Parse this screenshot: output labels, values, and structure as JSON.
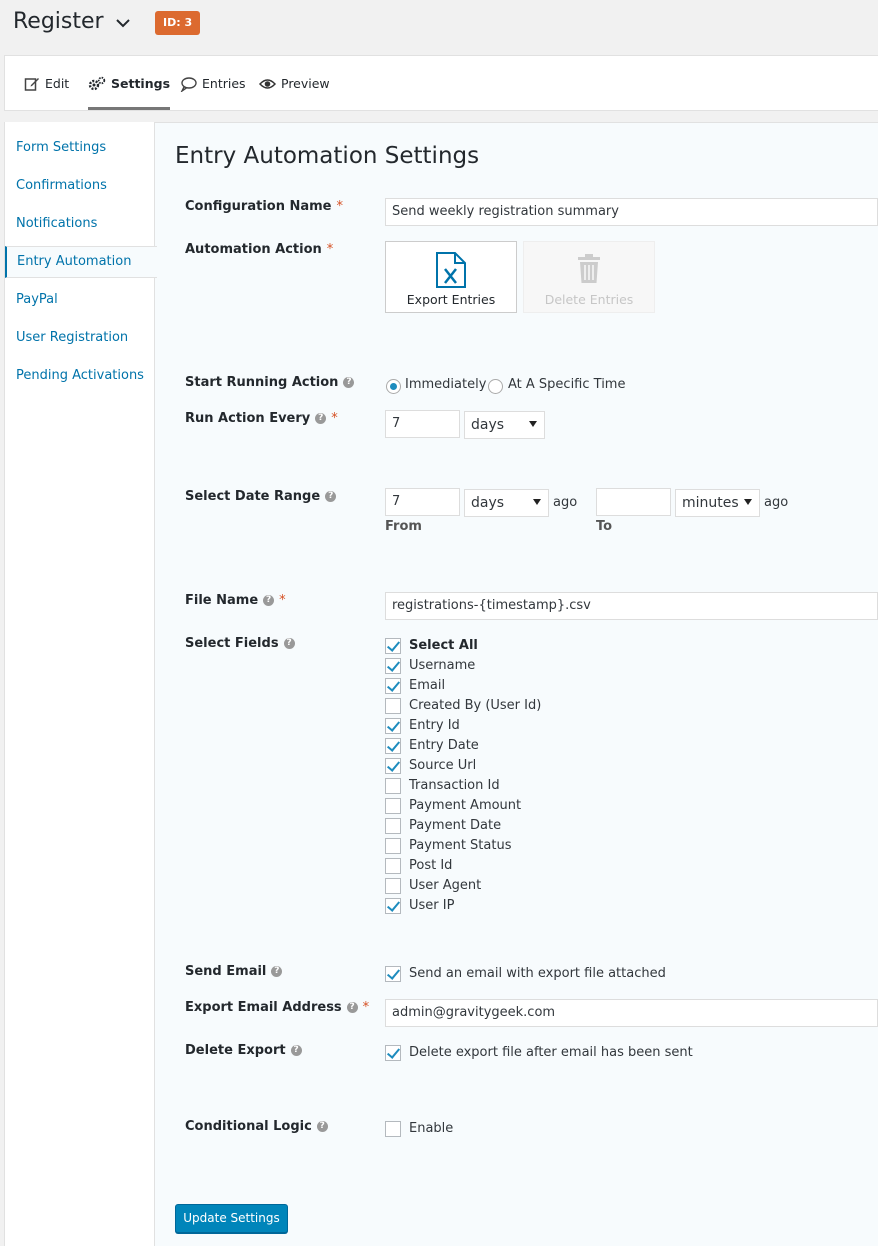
{
  "header": {
    "form_title": "Register",
    "id_badge": "ID: 3"
  },
  "toolbar": {
    "items": [
      {
        "label": "Edit",
        "icon": "edit-icon"
      },
      {
        "label": "Settings",
        "icon": "gears-icon",
        "active": true
      },
      {
        "label": "Entries",
        "icon": "comment-icon"
      },
      {
        "label": "Preview",
        "icon": "eye-icon"
      }
    ]
  },
  "sidebar": {
    "items": [
      {
        "label": "Form Settings"
      },
      {
        "label": "Confirmations"
      },
      {
        "label": "Notifications"
      },
      {
        "label": "Entry Automation",
        "active": true
      },
      {
        "label": "PayPal"
      },
      {
        "label": "User Registration"
      },
      {
        "label": "Pending Activations"
      }
    ]
  },
  "main": {
    "title": "Entry Automation Settings",
    "config_name": {
      "label": "Configuration Name",
      "value": "Send weekly registration summary"
    },
    "automation_action": {
      "label": "Automation Action",
      "options": [
        {
          "label": "Export Entries",
          "icon": "excel-file-icon",
          "selected": true
        },
        {
          "label": "Delete Entries",
          "icon": "trash-icon",
          "disabled": true
        }
      ]
    },
    "start_running": {
      "label": "Start Running Action",
      "options": [
        {
          "label": "Immediately",
          "checked": true
        },
        {
          "label": "At A Specific Time",
          "checked": false
        }
      ]
    },
    "run_every": {
      "label": "Run Action Every",
      "value": "7",
      "unit": "days"
    },
    "date_range": {
      "label": "Select Date Range",
      "from_value": "7",
      "from_unit": "days",
      "from_suffix": "ago",
      "from_label": "From",
      "to_value": "",
      "to_unit": "minutes",
      "to_suffix": "ago",
      "to_label": "To"
    },
    "file_name": {
      "label": "File Name",
      "value": "registrations-{timestamp}.csv"
    },
    "select_fields": {
      "label": "Select Fields",
      "fields": [
        {
          "label": "Select All",
          "checked": true,
          "bold": true
        },
        {
          "label": "Username",
          "checked": true
        },
        {
          "label": "Email",
          "checked": true
        },
        {
          "label": "Created By (User Id)",
          "checked": false
        },
        {
          "label": "Entry Id",
          "checked": true
        },
        {
          "label": "Entry Date",
          "checked": true
        },
        {
          "label": "Source Url",
          "checked": true
        },
        {
          "label": "Transaction Id",
          "checked": false
        },
        {
          "label": "Payment Amount",
          "checked": false
        },
        {
          "label": "Payment Date",
          "checked": false
        },
        {
          "label": "Payment Status",
          "checked": false
        },
        {
          "label": "Post Id",
          "checked": false
        },
        {
          "label": "User Agent",
          "checked": false
        },
        {
          "label": "User IP",
          "checked": true
        }
      ]
    },
    "send_email": {
      "label": "Send Email",
      "option": "Send an email with export file attached",
      "checked": true
    },
    "export_email": {
      "label": "Export Email Address",
      "value": "admin@gravitygeek.com"
    },
    "delete_export": {
      "label": "Delete Export",
      "option": "Delete export file after email has been sent",
      "checked": true
    },
    "conditional_logic": {
      "label": "Conditional Logic",
      "option": "Enable",
      "checked": false
    },
    "update_button": "Update Settings"
  },
  "colors": {
    "link": "#0073aa",
    "primary_button": "#0085ba",
    "badge": "#dc6a2f",
    "required": "#d54e21"
  }
}
